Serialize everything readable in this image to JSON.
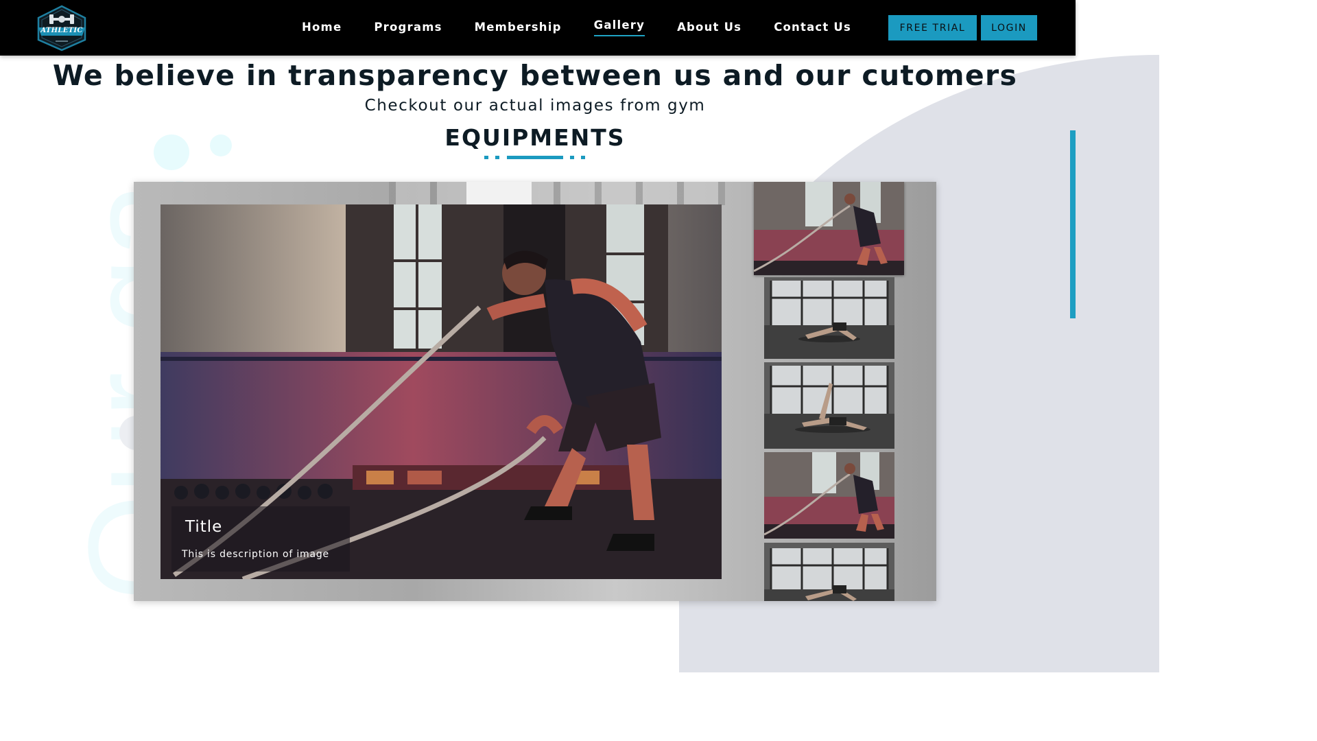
{
  "brand": {
    "logo_text": "ATHLETIC"
  },
  "nav": {
    "items": [
      {
        "label": "Home"
      },
      {
        "label": "Programs"
      },
      {
        "label": "Membership"
      },
      {
        "label": "Gallery",
        "active": true
      },
      {
        "label": "About Us"
      },
      {
        "label": "Contact Us"
      }
    ],
    "free_trial_label": "FREE TRIAL",
    "login_label": "LOGIN"
  },
  "background": {
    "vertical_text": "Our ga"
  },
  "hero": {
    "headline": "We believe in transparency between us and our cutomers",
    "subheadline": "Checkout our actual images from gym",
    "section_title": "EQUIPMENTS"
  },
  "gallery": {
    "main": {
      "title": "Title",
      "description": "This is description of image",
      "image": "battle-ropes-workout"
    },
    "thumbnails": [
      {
        "image": "battle-ropes-workout",
        "selected": true
      },
      {
        "image": "plank-pushup-workout"
      },
      {
        "image": "side-plank-workout"
      },
      {
        "image": "battle-ropes-workout"
      },
      {
        "image": "plank-pushup-workout"
      }
    ]
  },
  "colors": {
    "accent": "#1b9ac0",
    "navbar": "#000000",
    "text": "#0d1b24"
  }
}
